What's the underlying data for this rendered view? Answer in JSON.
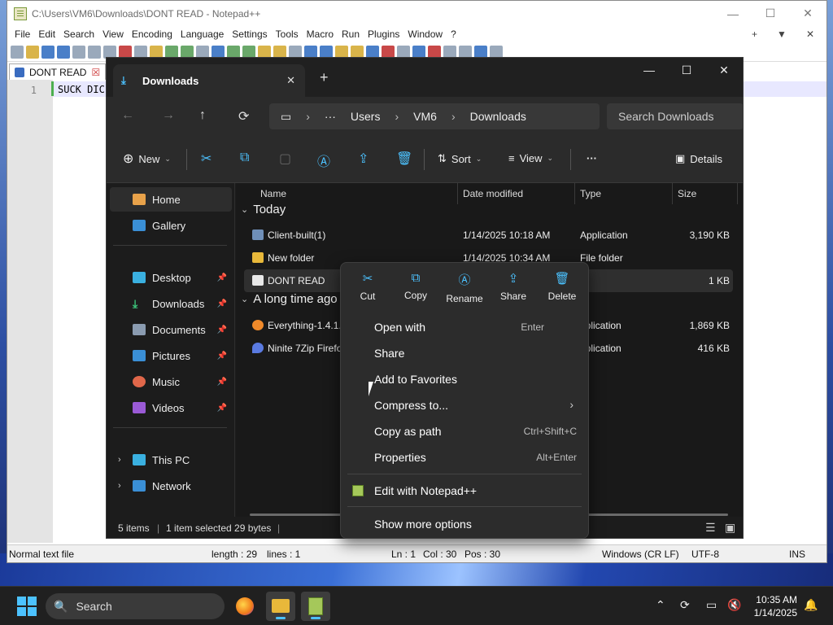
{
  "notepad": {
    "title": "C:\\Users\\VM6\\Downloads\\DONT READ - Notepad++",
    "window_buttons": [
      "—",
      "☐",
      "✕"
    ],
    "menu": [
      "File",
      "Edit",
      "Search",
      "View",
      "Encoding",
      "Language",
      "Settings",
      "Tools",
      "Macro",
      "Run",
      "Plugins",
      "Window",
      "?"
    ],
    "menu_right": [
      "+",
      "▼",
      "✕"
    ],
    "tab": {
      "label": "DONT READ",
      "close": "☒"
    },
    "editor": {
      "line_number": "1",
      "text": "SUCK DIC"
    },
    "status": {
      "file_type": "Normal text file",
      "length": "length : 29",
      "lines": "lines : 1",
      "ln": "Ln : 1",
      "col": "Col : 30",
      "pos": "Pos : 30",
      "eol": "Windows (CR LF)",
      "encoding": "UTF-8",
      "mode": "INS"
    }
  },
  "explorer": {
    "tab_title": "Downloads",
    "tab_close": "✕",
    "new_tab": "+",
    "window_buttons": [
      "—",
      "☐",
      "✕"
    ],
    "nav": {
      "back": "←",
      "forward": "→",
      "up": "↑",
      "refresh": "⟳"
    },
    "address": {
      "pc": "▭",
      "more": "···",
      "parts": [
        "Users",
        "VM6",
        "Downloads"
      ],
      "sep": "›"
    },
    "search_placeholder": "Search Downloads",
    "commands": {
      "new": "New",
      "sort": "Sort",
      "view": "View",
      "more": "···",
      "details": "Details"
    },
    "sidebar": {
      "home": "Home",
      "gallery": "Gallery",
      "desktop": "Desktop",
      "downloads": "Downloads",
      "documents": "Documents",
      "pictures": "Pictures",
      "music": "Music",
      "videos": "Videos",
      "this_pc": "This PC",
      "network": "Network"
    },
    "columns": {
      "name": "Name",
      "date": "Date modified",
      "type": "Type",
      "size": "Size"
    },
    "groups": {
      "today": "Today",
      "older": "A long time ago"
    },
    "files": [
      {
        "name": "Client-built(1)",
        "date": "1/14/2025 10:18 AM",
        "type": "Application",
        "size": "3,190 KB"
      },
      {
        "name": "New folder",
        "date": "1/14/2025 10:34 AM",
        "type": "File folder",
        "size": ""
      },
      {
        "name": "DONT READ",
        "date": "",
        "type": "e",
        "size": "1 KB"
      },
      {
        "name": "Everything-1.4.1.",
        "date": "",
        "type": "pplication",
        "size": "1,869 KB"
      },
      {
        "name": "Ninite 7Zip Firefo",
        "date": "",
        "type": "pplication",
        "size": "416 KB"
      }
    ],
    "status": {
      "items": "5 items",
      "selected": "1 item selected  29 bytes",
      "bar": "|"
    }
  },
  "context_menu": {
    "quick_actions": [
      "Cut",
      "Copy",
      "Rename",
      "Share",
      "Delete"
    ],
    "items": [
      {
        "label": "Open with",
        "shortcut": "Enter"
      },
      {
        "label": "Share",
        "shortcut": ""
      },
      {
        "label": "Add to Favorites",
        "shortcut": ""
      },
      {
        "label": "Compress to...",
        "shortcut": ""
      },
      {
        "label": "Copy as path",
        "shortcut": "Ctrl+Shift+C"
      },
      {
        "label": "Properties",
        "shortcut": "Alt+Enter"
      }
    ],
    "notepad_item": "Edit with Notepad++",
    "more_options": "Show more options",
    "submenu_arrow": "›"
  },
  "taskbar": {
    "search_label": "Search",
    "time": "10:35 AM",
    "date": "1/14/2025",
    "accent": "#4cc2ff"
  }
}
